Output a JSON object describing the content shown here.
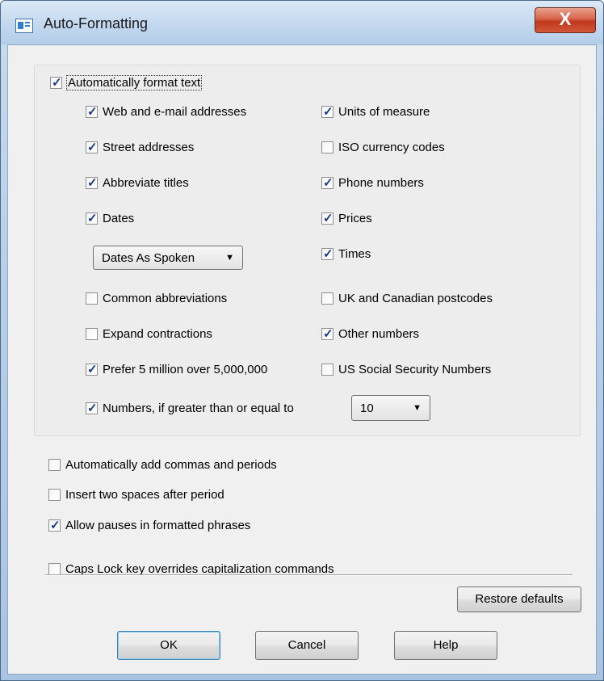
{
  "window": {
    "title": "Auto-Formatting",
    "close_label": "X"
  },
  "group": {
    "main_checkbox": {
      "label": "Automatically format text",
      "checked": true
    },
    "left_column": [
      {
        "label": "Web and e-mail addresses",
        "checked": true
      },
      {
        "label": "Street addresses",
        "checked": true
      },
      {
        "label": "Abbreviate titles",
        "checked": true
      },
      {
        "label": "Dates",
        "checked": true
      },
      {
        "label": "Common abbreviations",
        "checked": false
      },
      {
        "label": "Expand contractions",
        "checked": false
      },
      {
        "label": "Prefer 5 million over 5,000,000",
        "checked": true
      },
      {
        "label": "Numbers, if greater than or equal to",
        "checked": true
      }
    ],
    "right_column": [
      {
        "label": "Units of measure",
        "checked": true
      },
      {
        "label": "ISO currency codes",
        "checked": false
      },
      {
        "label": "Phone numbers",
        "checked": true
      },
      {
        "label": "Prices",
        "checked": true
      },
      {
        "label": "Times",
        "checked": true
      },
      {
        "label": "UK and Canadian postcodes",
        "checked": false
      },
      {
        "label": "Other numbers",
        "checked": true
      },
      {
        "label": "US Social Security Numbers",
        "checked": false
      }
    ],
    "dates_dropdown": {
      "value": "Dates As Spoken"
    },
    "numbers_dropdown": {
      "value": "10"
    }
  },
  "lower_options": [
    {
      "label": "Automatically add commas and periods",
      "checked": false
    },
    {
      "label": "Insert two spaces after period",
      "checked": false
    },
    {
      "label": "Allow pauses in formatted phrases",
      "checked": true
    },
    {
      "label": "Caps Lock key overrides capitalization commands",
      "checked": false
    }
  ],
  "buttons": {
    "restore": "Restore defaults",
    "ok": "OK",
    "cancel": "Cancel",
    "help": "Help"
  },
  "icons": {
    "dropdown_arrow": "▼"
  }
}
